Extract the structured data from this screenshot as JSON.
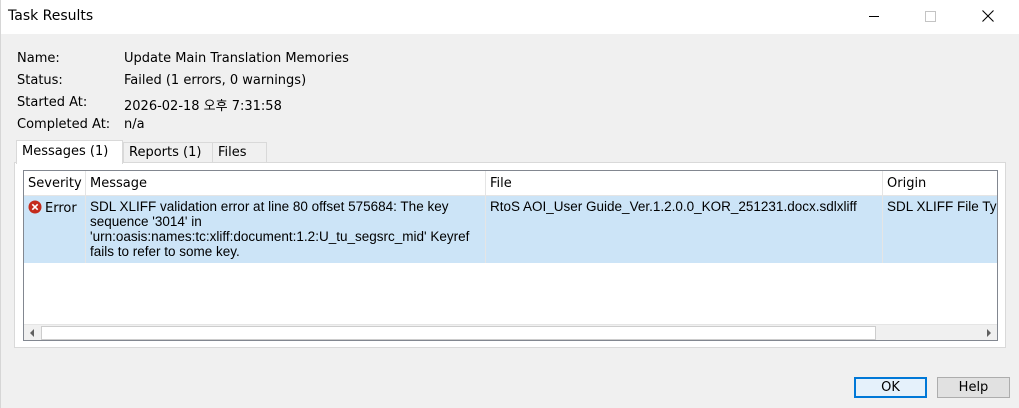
{
  "window": {
    "title": "Task Results"
  },
  "info": {
    "name_label": "Name:",
    "name_value": "Update Main Translation Memories",
    "status_label": "Status:",
    "status_value": "Failed (1 errors, 0 warnings)",
    "started_label": "Started At:",
    "started_value": "2026-02-18 오후 7:31:58",
    "completed_label": "Completed At:",
    "completed_value": "n/a"
  },
  "tabs": [
    {
      "label": "Messages (1)",
      "selected": true
    },
    {
      "label": "Reports (1)",
      "selected": false
    },
    {
      "label": "Files",
      "selected": false
    }
  ],
  "grid": {
    "columns": [
      "Severity",
      "Message",
      "File",
      "Origin"
    ],
    "rows": [
      {
        "severity": "Error",
        "message": "SDL XLIFF validation error at line 80 offset 575684: The key sequence '3014' in 'urn:oasis:names:tc:xliff:document:1.2:U_tu_segsrc_mid' Keyref fails to refer to some key.",
        "file": "RtoS AOI_User Guide_Ver.1.2.0.0_KOR_251231.docx.sdlxliff",
        "origin": "SDL XLIFF File Type"
      }
    ]
  },
  "buttons": {
    "ok": "OK",
    "help": "Help"
  },
  "colors": {
    "selection": "#cce4f7",
    "default_button_border": "#0078d7",
    "error_icon": "#c42b1c"
  }
}
